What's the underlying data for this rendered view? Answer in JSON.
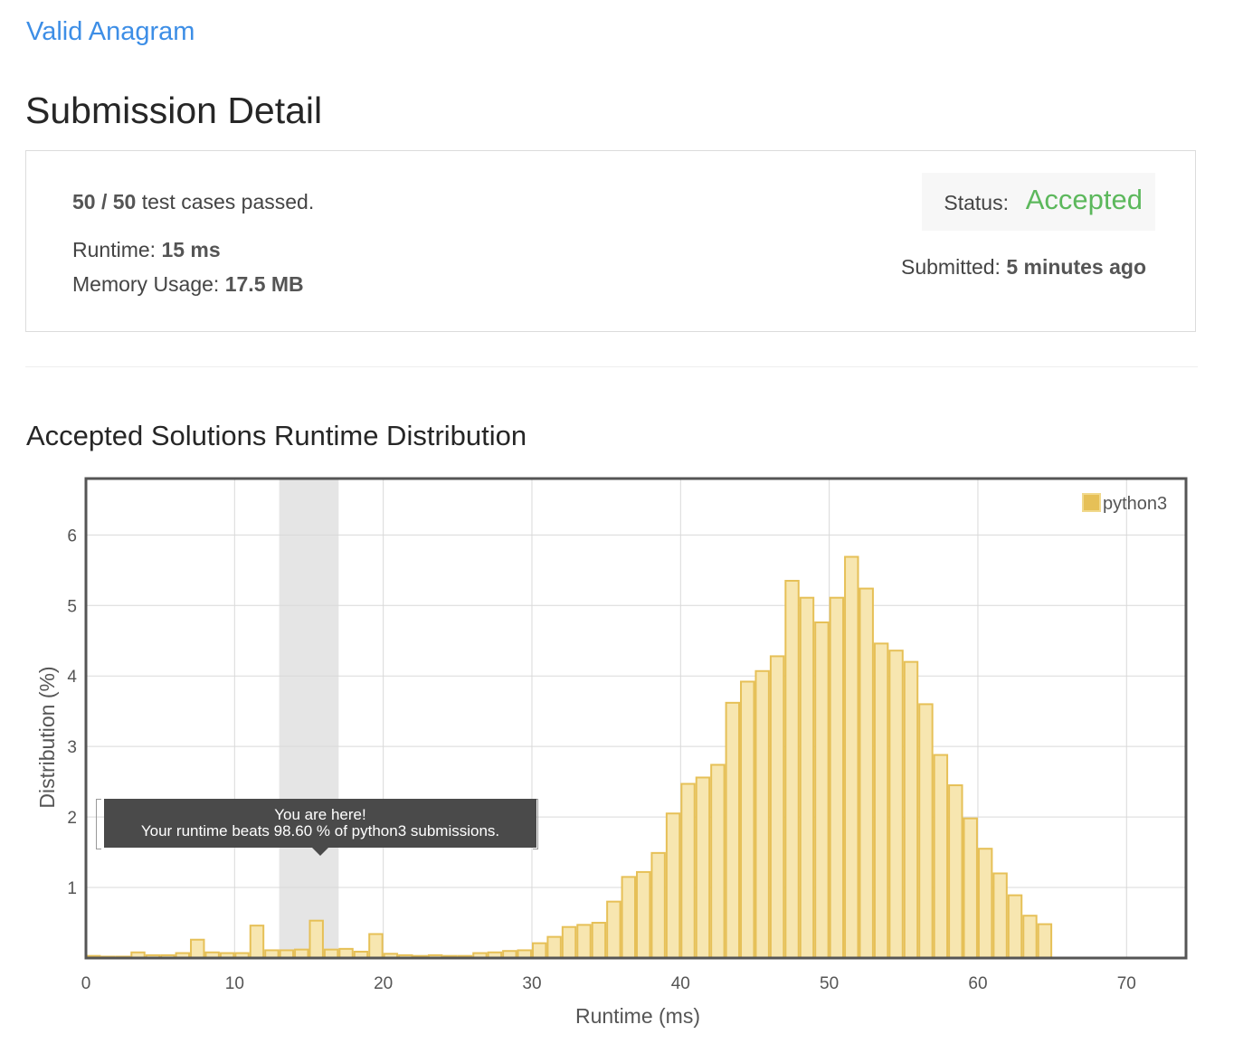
{
  "header": {
    "problem_link": "Valid Anagram",
    "page_title": "Submission Detail"
  },
  "details": {
    "cases_bold": "50 / 50",
    "cases_rest": " test cases passed.",
    "runtime_label": "Runtime: ",
    "runtime_value": "15 ms",
    "memory_label": "Memory Usage: ",
    "memory_value": "17.5 MB",
    "status_label": "Status: ",
    "status_value": "Accepted",
    "submitted_label": "Submitted: ",
    "submitted_value": "5 minutes ago"
  },
  "colors": {
    "link": "#3d8ee6",
    "accepted": "#5cb85c",
    "bar_fill": "#f7e6b0",
    "bar_stroke": "#e6c057",
    "highlight_band": "#e5e5e5"
  },
  "tooltip": {
    "line1": "You are here!",
    "line2": "Your runtime beats 98.60 % of python3 submissions."
  },
  "chart_data": {
    "type": "bar",
    "title": "Accepted Solutions Runtime Distribution",
    "xlabel": "Runtime (ms)",
    "ylabel": "Distribution (%)",
    "xlim": [
      0,
      74
    ],
    "ylim": [
      0,
      6.8
    ],
    "xticks": [
      0,
      10,
      20,
      30,
      40,
      50,
      60,
      70
    ],
    "yticks": [
      1,
      2,
      3,
      4,
      5,
      6
    ],
    "grid": true,
    "legend": "top-right",
    "highlight": {
      "x_start": 13,
      "x_end": 17,
      "current_runtime": 15
    },
    "series": [
      {
        "name": "python3",
        "bin_width": 1,
        "x": [
          0,
          1,
          2,
          3,
          4,
          5,
          6,
          7,
          8,
          9,
          10,
          11,
          12,
          13,
          14,
          15,
          16,
          17,
          18,
          19,
          20,
          21,
          22,
          23,
          24,
          25,
          26,
          27,
          28,
          29,
          30,
          31,
          32,
          33,
          34,
          35,
          36,
          37,
          38,
          39,
          40,
          41,
          42,
          43,
          44,
          45,
          46,
          47,
          48,
          49,
          50,
          51,
          52,
          53,
          54,
          55,
          56,
          57,
          58,
          59,
          60,
          61,
          62,
          63,
          64
        ],
        "values": [
          0.03,
          0.02,
          0.02,
          0.08,
          0.04,
          0.04,
          0.07,
          0.26,
          0.08,
          0.07,
          0.07,
          0.46,
          0.11,
          0.11,
          0.12,
          0.53,
          0.12,
          0.13,
          0.09,
          0.34,
          0.06,
          0.04,
          0.03,
          0.04,
          0.03,
          0.03,
          0.07,
          0.08,
          0.1,
          0.11,
          0.21,
          0.3,
          0.44,
          0.47,
          0.5,
          0.8,
          1.15,
          1.22,
          1.49,
          2.05,
          2.47,
          2.56,
          2.74,
          3.62,
          3.92,
          4.07,
          4.28,
          5.35,
          5.11,
          4.76,
          5.11,
          5.69,
          5.24,
          4.46,
          4.36,
          4.2,
          3.6,
          2.88,
          2.45,
          1.98,
          1.55,
          1.2,
          0.89,
          0.6,
          0.48
        ]
      }
    ]
  }
}
